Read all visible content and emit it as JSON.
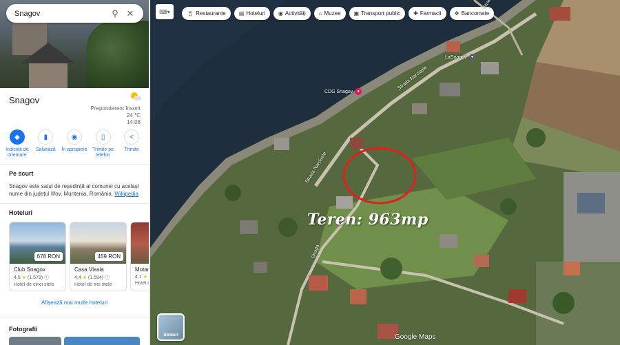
{
  "search": {
    "value": "Snagov"
  },
  "place": {
    "title": "Snagov",
    "weather": {
      "condition": "Preponderent însorit",
      "temperature": "24 °C",
      "time": "14:08"
    }
  },
  "actions": [
    {
      "label": "Indicații de orientare",
      "icon": "directions-icon"
    },
    {
      "label": "Salvează",
      "icon": "bookmark-icon"
    },
    {
      "label": "În apropiere",
      "icon": "nearby-icon"
    },
    {
      "label": "Trimite pe telefon",
      "icon": "phone-icon"
    },
    {
      "label": "Trimite",
      "icon": "share-icon"
    }
  ],
  "overview": {
    "title": "Pe scurt",
    "text": "Snagov este satul de reședință al comunei cu același nume din județul Ilfov, Muntenia, România.",
    "link": "Wikipedia"
  },
  "hotels_section": {
    "title": "Hoteluri",
    "items": [
      {
        "name": "Club Snagov",
        "price": "678 RON",
        "rating": "4,5",
        "reviews": "(1.579)",
        "class": "Hotel de cinci stele"
      },
      {
        "name": "Casa Vlasia",
        "price": "459 RON",
        "rating": "4,4",
        "reviews": "(1.594)",
        "class": "Hotel de trei stele"
      },
      {
        "name": "Motan",
        "price": "",
        "rating": "4,1",
        "reviews": "",
        "class": "Hotel de"
      }
    ],
    "more_link": "Afișează mai multe hoteluri"
  },
  "photos": {
    "title": "Fotografii"
  },
  "chips": [
    {
      "label": "Restaurante",
      "icon": "fork-knife-icon"
    },
    {
      "label": "Hoteluri",
      "icon": "bed-icon"
    },
    {
      "label": "Activități",
      "icon": "camera-icon"
    },
    {
      "label": "Muzee",
      "icon": "museum-icon"
    },
    {
      "label": "Transport public",
      "icon": "bus-icon"
    },
    {
      "label": "Farmacii",
      "icon": "pharmacy-icon"
    },
    {
      "label": "Bancomate",
      "icon": "atm-icon"
    }
  ],
  "map": {
    "overlay_text": "Teren: 963mp",
    "streets": [
      "Strada Narcisele",
      "Strada Narcisele",
      "Strada",
      "Strada"
    ],
    "pois": [
      "CDG Snagov",
      "LaSnagov"
    ],
    "layers_label": "Straturi",
    "logo": "Google Maps"
  }
}
